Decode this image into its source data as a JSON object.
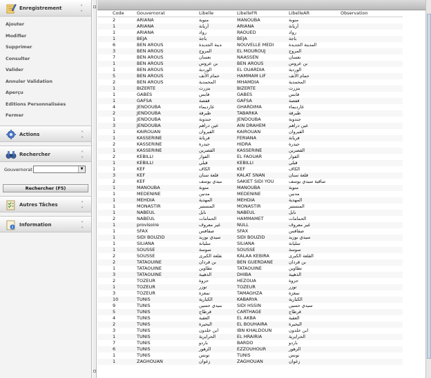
{
  "sidebar": {
    "enregistrement": {
      "title": "Enregistrement",
      "items": [
        "Ajouter",
        "Modifier",
        "Supprimer",
        "Consulter",
        "Valider",
        "Annuler Validation",
        "Aperçu",
        "Editions Personnalisées",
        "Fermer"
      ]
    },
    "actions": {
      "title": "Actions"
    },
    "rechercher": {
      "title": "Rechercher",
      "gouvernorat_label": "Gouvernorat",
      "gouvernorat_value": "",
      "button": "Rechercher (F5)"
    },
    "autres": {
      "title": "Autres Tâches"
    },
    "information": {
      "title": "Information"
    }
  },
  "grid": {
    "columns": [
      "Code",
      "Gouvernorat",
      "Libelle",
      "LibelleFR",
      "LibelleAR",
      "Observation"
    ],
    "rows": [
      [
        "2",
        "ARIANA",
        "منوبة",
        "MANOUBA",
        "منوبة",
        ""
      ],
      [
        "1",
        "ARIANA",
        "أريانة",
        "ARIANA",
        "أريانة",
        ""
      ],
      [
        "1",
        "ARIANA",
        "رواد",
        "RAOUED",
        "رواد",
        ""
      ],
      [
        "1",
        "BEJA",
        "باجة",
        "BEJA",
        "باجة",
        ""
      ],
      [
        "6",
        "BEN AROUS",
        "المدينة الجديدة",
        "NOUVELLE MEDINA",
        "المدينة الجديدة",
        ""
      ],
      [
        "3",
        "BEN AROUS",
        "المروج",
        "EL MOUROUJ",
        "المروج",
        ""
      ],
      [
        "7",
        "BEN AROUS",
        "نعسان",
        "NAASSEN",
        "نعسان",
        ""
      ],
      [
        "1",
        "BEN AROUS",
        "بن عروس",
        "BEN AROUS",
        "بن عروس",
        ""
      ],
      [
        "1",
        "BEN AROUS",
        "الوردية",
        "EL OUARDIA",
        "الوردية",
        ""
      ],
      [
        "5",
        "BEN AROUS",
        "حمام الأنف",
        "HAMMAM LIF",
        "حمام الأنف",
        ""
      ],
      [
        "2",
        "BEN AROUS",
        "المحمدية",
        "MHAMDIA",
        "المحمدية",
        ""
      ],
      [
        "1",
        "BIZERTE",
        "بنزرت",
        "BIZERTE",
        "بنزرت",
        ""
      ],
      [
        "1",
        "GABES",
        "قابس",
        "GABES",
        "قابس",
        ""
      ],
      [
        "1",
        "GAFSA",
        "قفصة",
        "GAFSA",
        "قفصة",
        ""
      ],
      [
        "4",
        "JENDOUBA",
        "غارديماء",
        "GHARDIMA",
        "غارديماء",
        ""
      ],
      [
        "2",
        "JENDOUBA",
        "طبرقة",
        "TABARKA",
        "طبرقة",
        ""
      ],
      [
        "1",
        "JENDOUBA",
        "جندوبة",
        "JENDOUBA",
        "جندوبة",
        ""
      ],
      [
        "3",
        "JENDOUBA",
        "عين دراهم",
        "AIN DRAHEM",
        "عين دراهم",
        ""
      ],
      [
        "1",
        "KAIROUAN",
        "القيروان",
        "KAIROUAN",
        "القيروان",
        ""
      ],
      [
        "1",
        "KASSERINE",
        "فريانة",
        "FERIANA",
        "فريانة",
        ""
      ],
      [
        "2",
        "KASSERINE",
        "حيدرة",
        "HIDRA",
        "حيدرة",
        ""
      ],
      [
        "1",
        "KASSERINE",
        "القصرين",
        "KASSERINE",
        "القصرين",
        ""
      ],
      [
        "2",
        "KEBILLI",
        "الفوار",
        "EL FAOUAR",
        "الفوار",
        ""
      ],
      [
        "1",
        "KEBILLI",
        "قبلي",
        "KEBILLI",
        "قبلي",
        ""
      ],
      [
        "1",
        "KEF",
        "الكاف",
        "KEF",
        "الكاف",
        ""
      ],
      [
        "3",
        "KEF",
        "قلعة سنان",
        "KALAT SNAN",
        "قلعة سنان",
        ""
      ],
      [
        "2",
        "KEF",
        "ساقية سيدي يوسف",
        "SAKIET SIDI YOUSSEF",
        "ساقية سيدي يوسف",
        ""
      ],
      [
        "1",
        "MANOUBA",
        "منوبة",
        "MANOUBA",
        "منوبة",
        ""
      ],
      [
        "1",
        "MEDENINE",
        "مدنين",
        "MEDENINE",
        "مدنين",
        ""
      ],
      [
        "1",
        "MEHDIA",
        "المهدية",
        "MEHDIA",
        "المهدية",
        ""
      ],
      [
        "1",
        "MONASTIR",
        "المنستير",
        "MONASTIR",
        "المنستير",
        ""
      ],
      [
        "1",
        "NABEUL",
        "نابل",
        "NABEUL",
        "نابل",
        ""
      ],
      [
        "2",
        "NABEUL",
        "الحمامات",
        "HAMMAMET",
        "الحمامات",
        ""
      ],
      [
        "1",
        "provisoire",
        "غير معروف",
        "NULL",
        "غير معروف",
        ""
      ],
      [
        "1",
        "SFAX",
        "صفاقس",
        "SFAX",
        "صفاقس",
        ""
      ],
      [
        "1",
        "SIDI BOUZID",
        "سيدي بوزيد",
        "SIDI BOUZID",
        "سيدي بوزيد",
        ""
      ],
      [
        "1",
        "SILIANA",
        "سليانة",
        "SILIANA",
        "سليانة",
        ""
      ],
      [
        "1",
        "SOUSSE",
        "سوسة",
        "SOUSSE",
        "سوسة",
        ""
      ],
      [
        "2",
        "SOUSSE",
        "القلعة الكبرى",
        "KALAA KEBIRA",
        "القلعة الكبرى",
        ""
      ],
      [
        "2",
        "TATAOUINE",
        "بن قردان",
        "BEN GUERDANE",
        "بن قردان",
        ""
      ],
      [
        "1",
        "TATAOUINE",
        "تطاوين",
        "TATAOUINE",
        "تطاوين",
        ""
      ],
      [
        "3",
        "TATAOUINE",
        "الذهيبة",
        "DHIBA",
        "الذهيبة",
        ""
      ],
      [
        "2",
        "TOZEUR",
        "حزوة",
        "HEZOUA",
        "حزوة",
        ""
      ],
      [
        "1",
        "TOZEUR",
        "توزر",
        "TOZEUR",
        "توزر",
        ""
      ],
      [
        "3",
        "TOZEUR",
        "تمغزة",
        "TAMAGHZA",
        "تمغزة",
        ""
      ],
      [
        "10",
        "TUNIS",
        "الكبارية",
        "KABARYA",
        "الكبارية",
        ""
      ],
      [
        "9",
        "TUNIS",
        "سيدي حسين",
        "SIDI HSSIN",
        "سيدي حسين",
        ""
      ],
      [
        "5",
        "TUNIS",
        "قرطاج",
        "CARTHAGE",
        "قرطاج",
        ""
      ],
      [
        "4",
        "TUNIS",
        "العقبة",
        "EL AKBA",
        "العقبة",
        ""
      ],
      [
        "2",
        "TUNIS",
        "البحيرة",
        "EL BOUHAIRA",
        "البحيرة",
        ""
      ],
      [
        "3",
        "TUNIS",
        "ابن خلدون",
        "IBN KHALDOUN",
        "ابن خلدون",
        ""
      ],
      [
        "1",
        "TUNIS",
        "الحرايرية",
        "EL HRAIRIA",
        "الحرايرية",
        ""
      ],
      [
        "7",
        "TUNIS",
        "باردو",
        "BARDO",
        "باردو",
        ""
      ],
      [
        "6",
        "TUNIS",
        "الزهور",
        "EZZOUHOUR",
        "الزهور",
        ""
      ],
      [
        "1",
        "TUNIS",
        "تونس",
        "TUNIS",
        "تونس",
        ""
      ],
      [
        "1",
        "ZAGHOUAN",
        "زغوان",
        "ZAGHOUAN",
        "زغوان",
        ""
      ]
    ]
  },
  "colors": {
    "sidebar_bg": "#f3f3f3",
    "header_bg": "#c9c9c9",
    "accent": "#e5a400",
    "scroll_thumb": "#cfd8e6"
  }
}
